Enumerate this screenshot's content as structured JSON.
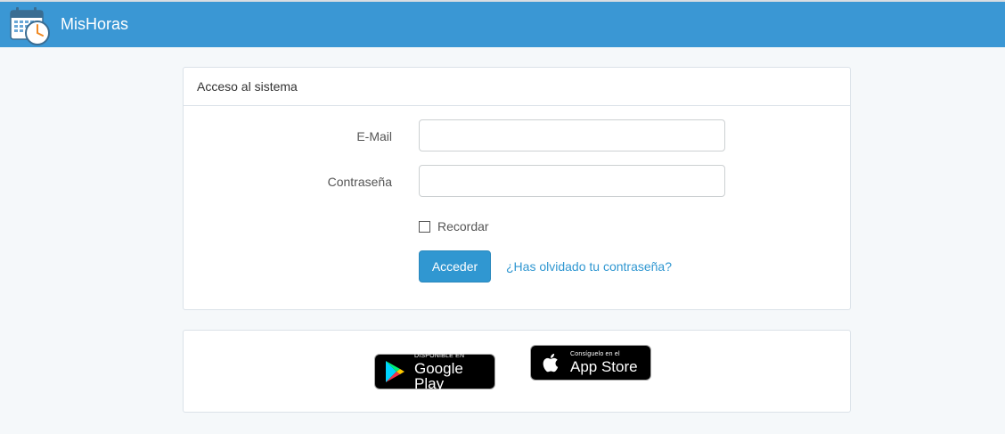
{
  "app": {
    "name": "MisHoras",
    "logo_icon": "calendar-clock-icon"
  },
  "colors": {
    "navbar": "#3a97d4",
    "primary_button": "#3097d1",
    "link": "#3097d1",
    "background": "#f5f8fa"
  },
  "login": {
    "heading": "Acceso al sistema",
    "email_label": "E-Mail",
    "email_value": "",
    "password_label": "Contraseña",
    "password_value": "",
    "remember_label": "Recordar",
    "remember_checked": false,
    "submit_label": "Acceder",
    "forgot_link": "¿Has olvidado tu contraseña?"
  },
  "apps": {
    "google_play": {
      "small": "DISPONIBLE EN",
      "big": "Google Play",
      "icon": "google-play-icon"
    },
    "app_store": {
      "small": "Consíguelo en el",
      "big": "App Store",
      "icon": "apple-icon"
    }
  }
}
